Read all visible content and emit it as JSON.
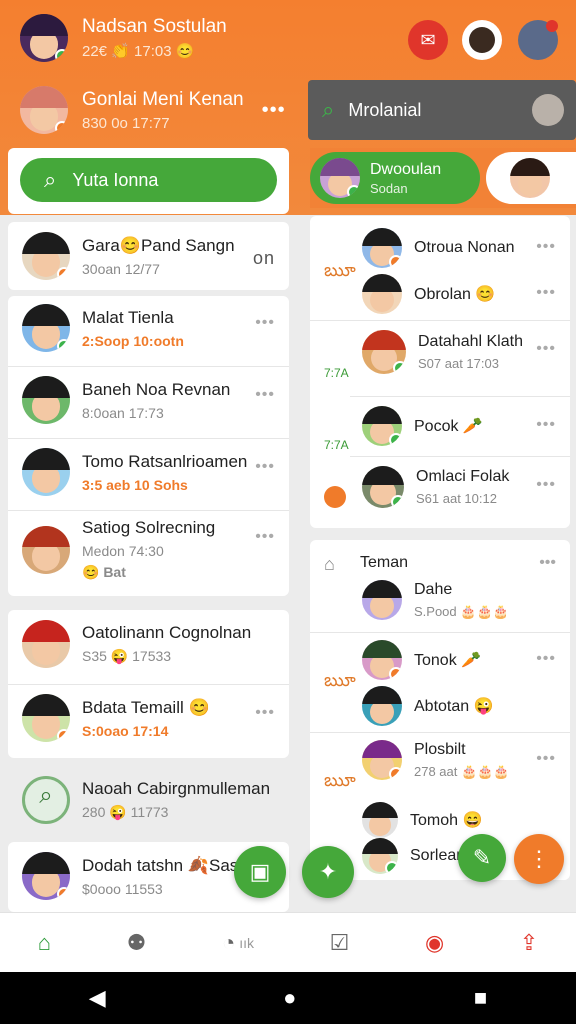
{
  "header": {
    "user1": {
      "name": "Nadsan Sostulan",
      "sub": "22€ 👏 17:03 😊"
    },
    "user2": {
      "name": "Gonlai Meni Kenan",
      "sub": "830 0o 17:77",
      "more": "•••"
    },
    "icons": [
      "mail-icon",
      "profile-avatar",
      "notification-avatar"
    ]
  },
  "left_search": {
    "label": "Yuta Ionna",
    "icon": "search-icon"
  },
  "right_search": {
    "label": "Mrolanial",
    "icon": "search-icon"
  },
  "right_active": {
    "name": "Dwooulan",
    "sub": "Sodan"
  },
  "left_list": [
    {
      "name": "Gara😊Pand Sangn",
      "sub": "30oan 12/77",
      "tail": "on"
    },
    {
      "name": "Malat Tienla",
      "sub": "2:Soop 10:ootn",
      "more": "•••"
    },
    {
      "name": "Baneh Noa Revnan",
      "sub": "8:0oan 17:73",
      "more": "•••"
    },
    {
      "name": "Tomo Ratsanlrioamen",
      "sub": "3:5 aeb 10 Sohs",
      "more": "•••"
    },
    {
      "name": "Satiog Solrecning",
      "sub": "Medon 74:30",
      "sub2": "😊 Bat",
      "more": "•••"
    },
    {
      "name": "Oatolinann Cognolnan",
      "sub": "S35 😜 17533",
      "more": ""
    },
    {
      "name": "Bdata Temaill 😊",
      "sub": "S:0oao 17:14",
      "more": "•••"
    },
    {
      "name": "Naoah Cabirgnmulleman",
      "sub": "280 😜 11773"
    },
    {
      "name": "Dodah tatshn 🍂Sas",
      "sub": "$0ooo 11553"
    }
  ],
  "right_group1": [
    {
      "name": "Otroua Nonan",
      "more": "•••"
    },
    {
      "name": "Obrolan 😊",
      "more": "•••"
    }
  ],
  "right_group2": [
    {
      "name": "Datahahl Klath",
      "sub": "S07 aat 17:03",
      "more": "•••"
    },
    {
      "name": "Pocok 🥕",
      "more": "•••"
    },
    {
      "name": "Omlaci Folak",
      "sub": "S61 aat 10:12",
      "more": "•••"
    }
  ],
  "right_group3": {
    "title": "Teman",
    "more": "•••",
    "items": [
      {
        "name": "Dahe",
        "sub": "S.Pood 🎂🎂🎂"
      },
      {
        "name": "Tonok 🥕",
        "more": "•••"
      },
      {
        "name": "Abtotan 😜"
      },
      {
        "name": "Plosbilt",
        "sub": "278 aat 🎂🎂🎂",
        "more": "•••"
      },
      {
        "name": "Tomoh 😄"
      },
      {
        "name": "Sorlean"
      }
    ]
  },
  "side_glyphs": {
    "g1": "ౠ",
    "g2": "7:7A",
    "g3": "7:7A"
  },
  "fabs": {
    "chat": "▣",
    "sticker": "✦",
    "edit": "✎",
    "more": "⋮"
  },
  "nav": {
    "items": [
      {
        "icon": "home-icon",
        "glyph": "⌂"
      },
      {
        "icon": "robot-icon",
        "glyph": "⚉"
      },
      {
        "icon": "timer-icon",
        "glyph": "◔",
        "label": "ıık"
      },
      {
        "icon": "tasks-icon",
        "glyph": "☑"
      },
      {
        "icon": "location-icon",
        "glyph": "◉"
      },
      {
        "icon": "share-icon",
        "glyph": "⇪"
      }
    ]
  },
  "system": {
    "back": "◀",
    "home": "●",
    "recent": "■"
  },
  "colors": {
    "brand_orange": "#f28236",
    "accent_green": "#45a83a"
  }
}
